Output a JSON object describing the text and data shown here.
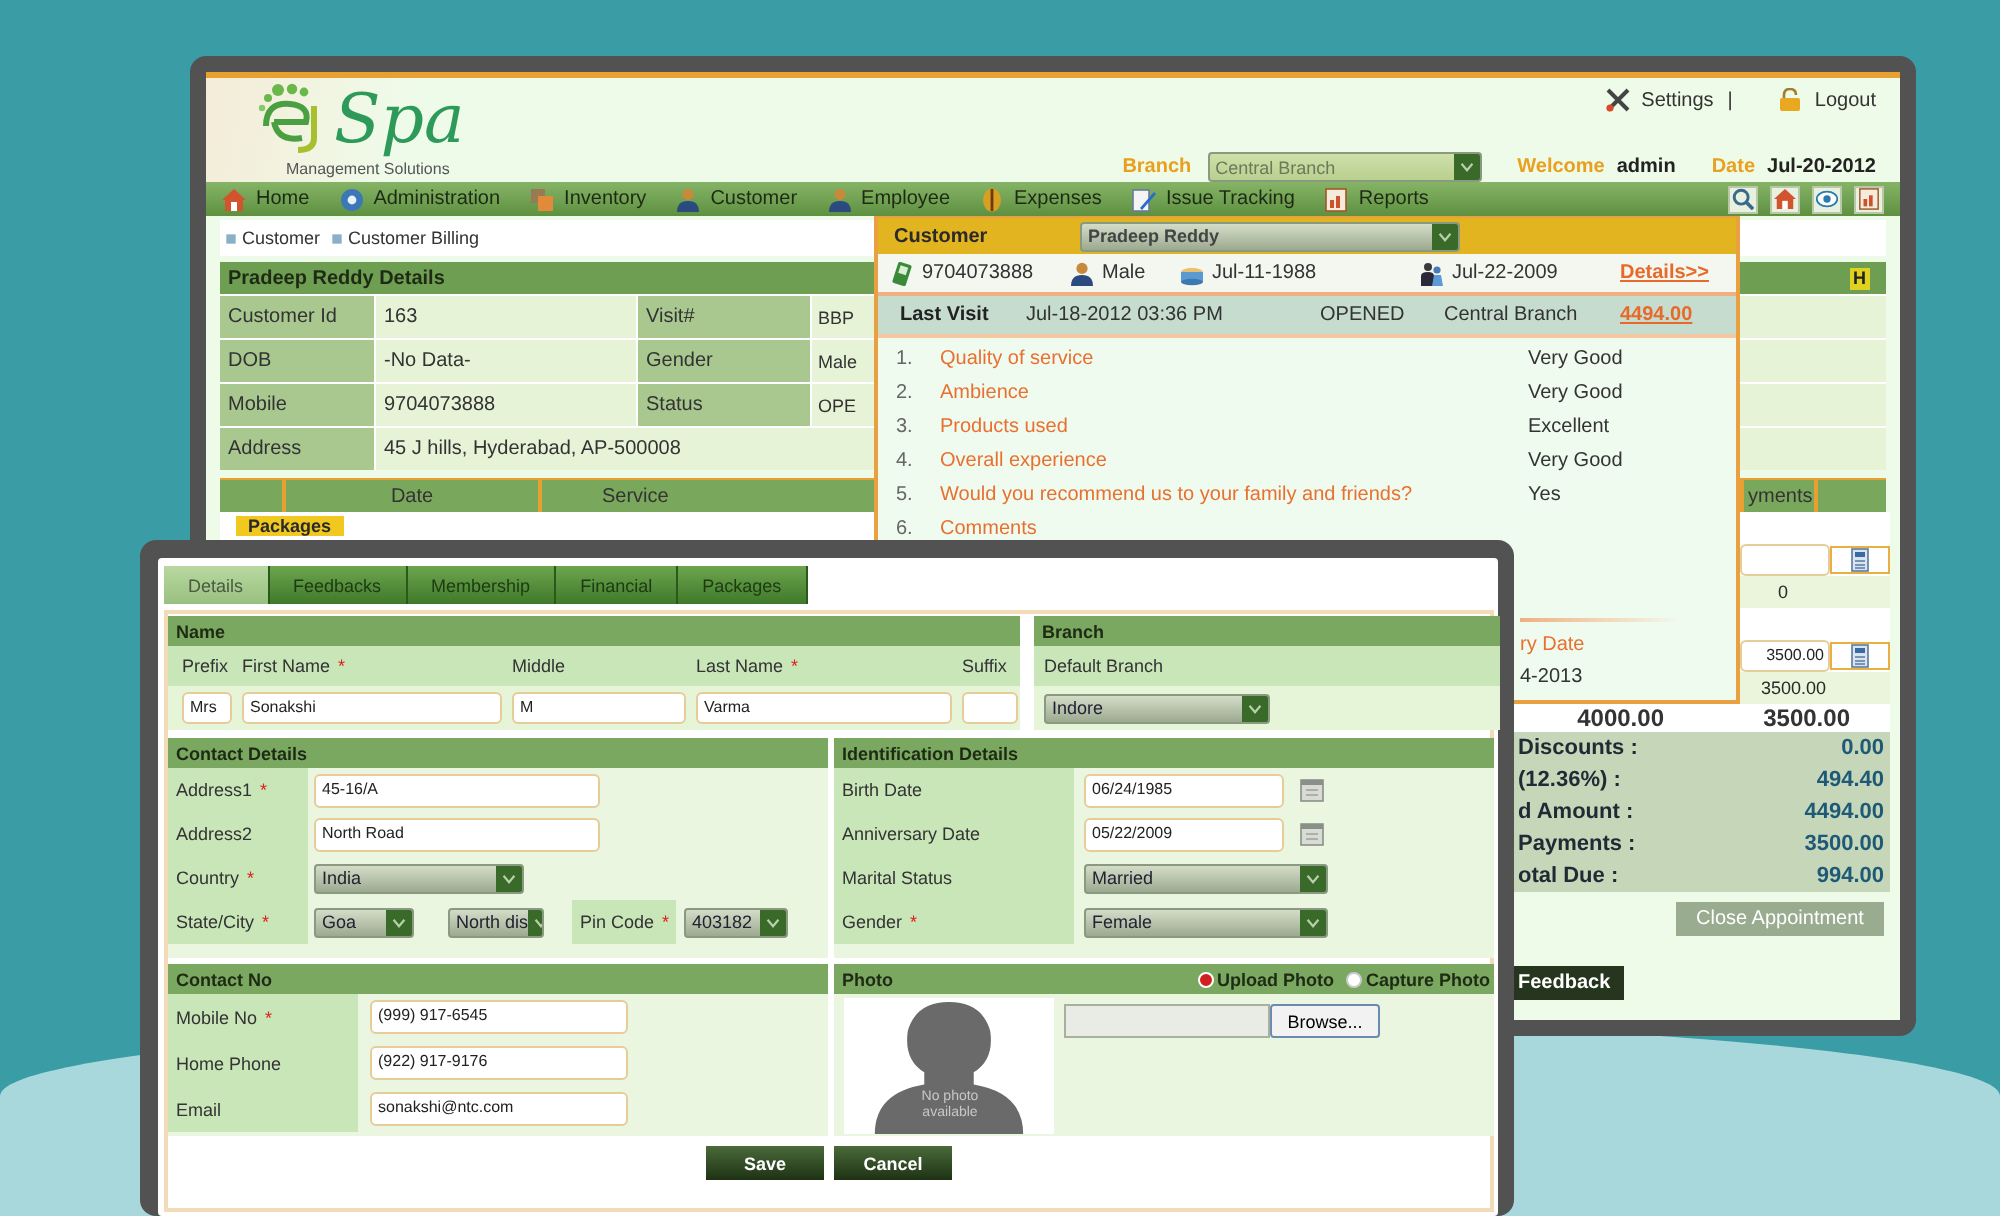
{
  "back_window": {
    "logo": {
      "title": "Spa",
      "tagline": "Management Solutions"
    },
    "top_links": [
      {
        "label": "Settings"
      },
      {
        "label": "Logout"
      }
    ],
    "separator": "|",
    "branch": {
      "label": "Branch",
      "value": "Central Branch"
    },
    "welcome": {
      "label": "Welcome",
      "value": "admin"
    },
    "date": {
      "label": "Date",
      "value": "Jul-20-2012"
    },
    "nav": [
      {
        "label": "Home"
      },
      {
        "label": "Administration"
      },
      {
        "label": "Inventory"
      },
      {
        "label": "Customer"
      },
      {
        "label": "Employee"
      },
      {
        "label": "Expenses"
      },
      {
        "label": "Issue Tracking"
      },
      {
        "label": "Reports"
      }
    ],
    "breadcrumb": [
      "Customer",
      "Customer Billing"
    ],
    "details": {
      "title": "Pradeep Reddy Details",
      "badge": "H",
      "rows": [
        {
          "label": "Customer Id",
          "value": "163",
          "label2": "Visit#",
          "value2": "BBP"
        },
        {
          "label": "DOB",
          "value": "-No Data-",
          "label2": "Gender",
          "value2": "Male"
        },
        {
          "label": "Mobile",
          "value": "9704073888",
          "label2": "Status",
          "value2": "OPE"
        },
        {
          "label": "Address",
          "value": "45 J hills, Hyderabad, AP-500008"
        }
      ]
    },
    "table": {
      "columns": [
        "Date",
        "Service"
      ],
      "right_column": "yments",
      "section": "Packages"
    },
    "amounts": [
      {
        "kind": "blank"
      },
      {
        "kind": "field"
      },
      {
        "kind": "text",
        "value": "0"
      },
      {
        "kind": "blank"
      },
      {
        "kind": "field",
        "value": "3500.00"
      },
      {
        "kind": "text",
        "value": "3500.00"
      },
      {
        "kind": "total",
        "values": [
          "4000.00",
          "3500.00"
        ]
      }
    ],
    "summary": [
      {
        "label": "Discounts :",
        "value": "0.00"
      },
      {
        "label": "(12.36%) :",
        "value": "494.40"
      },
      {
        "label": "d Amount :",
        "value": "4494.00"
      },
      {
        "label": "Payments :",
        "value": "3500.00"
      },
      {
        "label": "otal Due :",
        "value": "994.00"
      }
    ],
    "close_button": "Close Appointment",
    "feedback_button": "Feedback"
  },
  "popup": {
    "label": "Customer",
    "value": "Pradeep Reddy",
    "phone": "9704073888",
    "gender": "Male",
    "birthday": "Jul-11-1988",
    "anniversary": "Jul-22-2009",
    "details_link": "Details>>",
    "last_visit": {
      "label": "Last Visit",
      "time": "Jul-18-2012 03:36 PM",
      "status": "OPENED",
      "branch": "Central Branch",
      "amount": "4494.00"
    },
    "feedback": [
      {
        "number": "1.",
        "question": "Quality of service",
        "answer": "Very Good"
      },
      {
        "number": "2.",
        "question": "Ambience",
        "answer": "Very Good"
      },
      {
        "number": "3.",
        "question": "Products used",
        "answer": "Excellent"
      },
      {
        "number": "4.",
        "question": "Overall experience",
        "answer": "Very Good"
      },
      {
        "number": "5.",
        "question": "Would you recommend us to your family and friends?",
        "answer": "Yes"
      },
      {
        "number": "6.",
        "question": "Comments"
      }
    ],
    "next": {
      "label": "ry Date",
      "value": "4-2013"
    }
  },
  "front_window": {
    "tabs": [
      {
        "label": "Details",
        "selected": true
      },
      {
        "label": "Feedbacks",
        "selected": false
      },
      {
        "label": "Membership",
        "selected": false
      },
      {
        "label": "Financial",
        "selected": false
      },
      {
        "label": "Packages",
        "selected": false
      }
    ],
    "name_section": {
      "title": "Name",
      "fields": [
        {
          "label": "Prefix",
          "value": "Mrs"
        },
        {
          "label": "First Name",
          "mark": "*",
          "value": "Sonakshi"
        },
        {
          "label": "Middle",
          "value": "M"
        },
        {
          "label": "Last Name",
          "mark": "*",
          "value": "Varma"
        },
        {
          "label": "Suffix"
        }
      ]
    },
    "branch_section": {
      "title": "Branch",
      "label": "Default Branch",
      "value": "Indore"
    },
    "contact": {
      "title": "Contact Details",
      "rows": [
        {
          "label": "Address1",
          "mark": "*",
          "kind": "input",
          "value": "45-16/A"
        },
        {
          "label": "Address2",
          "kind": "input",
          "value": "North Road"
        },
        {
          "label": "Country",
          "mark": "*",
          "kind": "select",
          "value": "India"
        },
        {
          "label": "State/City",
          "mark": "*",
          "kind": "state",
          "values": [
            "Goa",
            "North dis"
          ],
          "pin": {
            "label": "Pin Code",
            "mark": "*",
            "value": "403182"
          }
        }
      ]
    },
    "identification": {
      "title": "Identification Details",
      "rows": [
        {
          "label": "Birth Date",
          "kind": "date",
          "value": "06/24/1985"
        },
        {
          "label": "Anniversary Date",
          "kind": "date",
          "value": "05/22/2009"
        },
        {
          "label": "Marital Status",
          "kind": "select",
          "value": "Married"
        },
        {
          "label": "Gender",
          "mark": "*",
          "kind": "select",
          "value": "Female"
        }
      ]
    },
    "contact_no": {
      "title": "Contact No",
      "rows": [
        {
          "label": "Mobile No",
          "mark": "*",
          "kind": "input",
          "value": "(999) 917-6545"
        },
        {
          "label": "Home Phone",
          "kind": "input",
          "value": "(922) 917-9176"
        },
        {
          "label": "Email",
          "kind": "input",
          "value": "sonakshi@ntc.com"
        }
      ]
    },
    "photo": {
      "title": "Photo",
      "options": [
        {
          "label": "Upload Photo",
          "selected": true
        },
        {
          "label": "Capture Photo",
          "selected": false
        }
      ],
      "placeholder_text": "No photo available",
      "browse": "Browse..."
    },
    "buttons": [
      "Save",
      "Cancel"
    ]
  }
}
